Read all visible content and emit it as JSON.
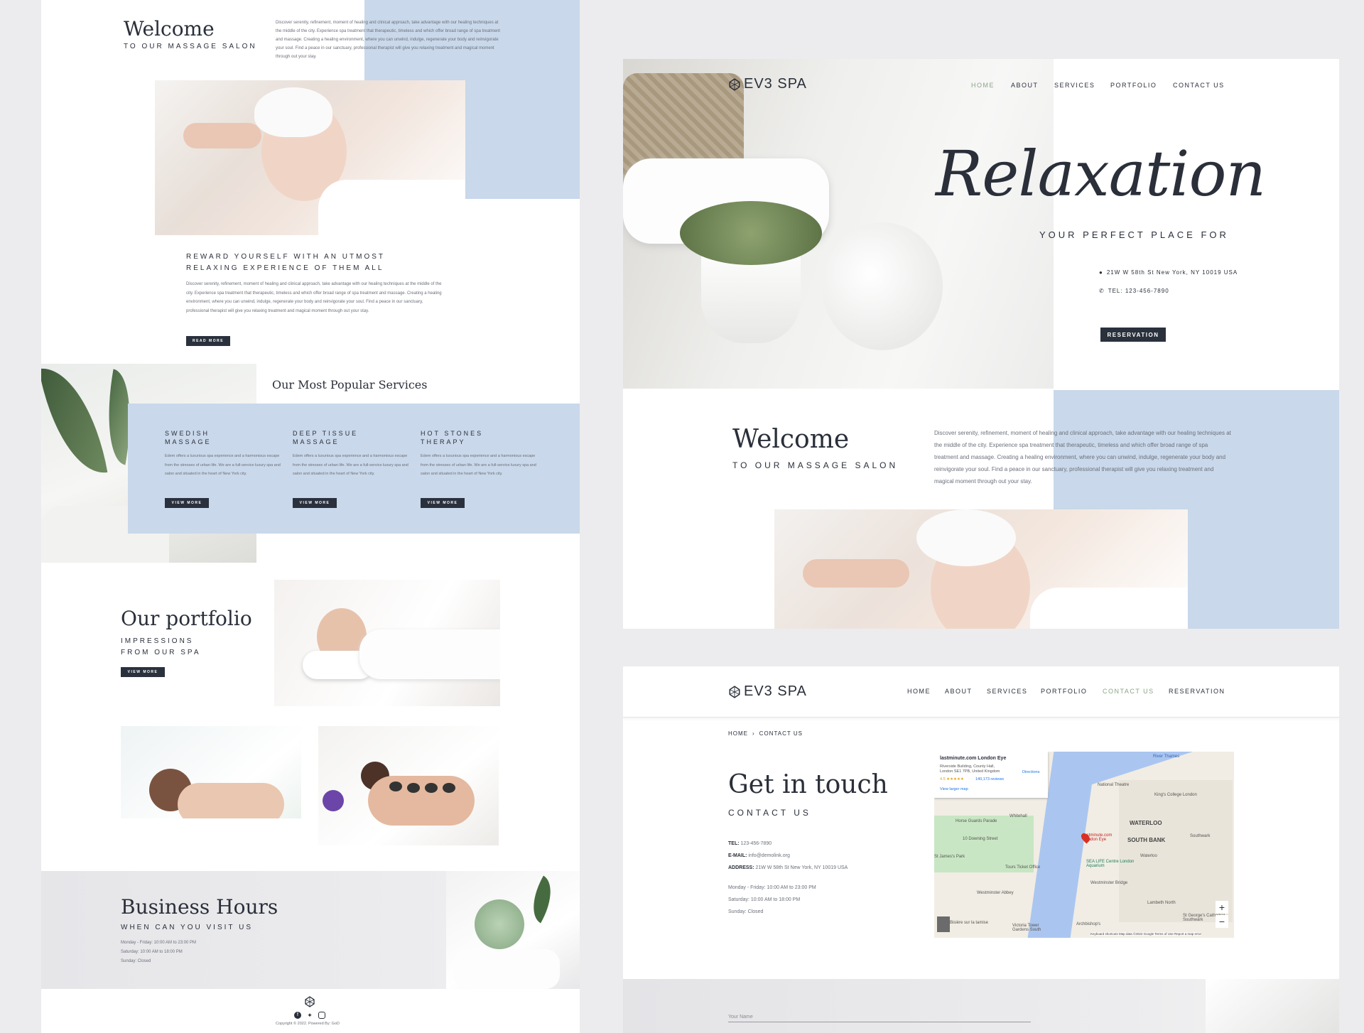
{
  "left_page": {
    "welcome": {
      "title": "Welcome",
      "subtitle": "TO OUR MASSAGE SALON",
      "body": "Discover serenity, refinement, moment of healing and clinical approach, take advantage with our healing techniques at the middle of the city. Experience spa treatment that therapeutic, timeless and which offer broad range of spa treatment and massage. Creating a healing environment, where you can unwind, indulge, regenerate your body and reinvigorate your soul. Find a peace in our sanctuary, professional therapist will give you relaxing treatment and magical moment through out your stay."
    },
    "reward": {
      "heading_line1": "REWARD YOURSELF WITH AN UTMOST",
      "heading_line2": "RELAXING EXPERIENCE OF THEM ALL",
      "body": "Discover serenity, refinement, moment of healing and clinical approach, take advantage with our healing techniques at the middle of the city. Experience spa treatment that therapeutic, timeless and which offer broad range of spa treatment and massage. Creating a healing environment, where you can unwind, indulge, regenerate your body and reinvigorate your soul. Find a peace in our sanctuary, professional therapist will give you relaxing treatment and magical moment through out your stay.",
      "button": "READ MORE"
    },
    "services": {
      "title": "Our Most Popular Services",
      "items": [
        {
          "line1": "SWEDISH",
          "line2": "MASSAGE",
          "body": "Edem offers a luxurious spa experience and a harmonious escape from the stresses of urban life. We are a full-service luxury spa and salon and situated in the heart of New York city.",
          "button": "VIEW MORE"
        },
        {
          "line1": "DEEP TISSUE",
          "line2": "MASSAGE",
          "body": "Edem offers a luxurious spa experience and a harmonious escape from the stresses of urban life. We are a full-service luxury spa and salon and situated in the heart of New York city.",
          "button": "VIEW MORE"
        },
        {
          "line1": "HOT STONES",
          "line2": "THERAPY",
          "body": "Edem offers a luxurious spa experience and a harmonious escape from the stresses of urban life. We are a full-service luxury spa and salon and situated in the heart of New York city.",
          "button": "VIEW MORE"
        }
      ]
    },
    "portfolio": {
      "title": "Our portfolio",
      "sub1": "IMPRESSIONS",
      "sub2": "FROM OUR SPA",
      "button": "VIEW MORE"
    },
    "hours": {
      "title": "Business Hours",
      "subtitle": "WHEN CAN YOU VISIT US",
      "line1": "Monday - Friday: 10:00 AM to 23:00 PM",
      "line2": "Saturday: 10:00 AM to 18:00 PM",
      "line3": "Sunday: Closed"
    },
    "footer": {
      "copyright": "Copyright © 2022. Powered By: GoD"
    }
  },
  "hero_page": {
    "logo": "EV3 SPA",
    "nav": [
      "HOME",
      "ABOUT",
      "SERVICES",
      "PORTFOLIO",
      "CONTACT US"
    ],
    "script_title": "Relaxation",
    "tagline": "YOUR PERFECT PLACE FOR",
    "address": "21W W 58th St New York, NY 10019 USA",
    "phone": "TEL: 123-456-7890",
    "button": "RESERVATION",
    "welcome_title": "Welcome",
    "welcome_subtitle": "TO OUR MASSAGE SALON",
    "welcome_body": "Discover serenity, refinement, moment of healing and clinical approach, take advantage with our healing techniques at the middle of the city. Experience spa treatment that therapeutic, timeless and which offer broad range of spa treatment and massage. Creating a healing environment, where you can unwind, indulge, regenerate your body and reinvigorate your soul. Find a peace in our sanctuary, professional therapist will give you relaxing treatment and magical moment through out your stay."
  },
  "contact_page": {
    "logo": "EV3 SPA",
    "nav": [
      "HOME",
      "ABOUT",
      "SERVICES",
      "PORTFOLIO",
      "CONTACT US",
      "RESERVATION"
    ],
    "breadcrumb_home": "HOME",
    "breadcrumb_current": "CONTACT US",
    "title": "Get in touch",
    "subtitle": "CONTACT US",
    "tel_label": "TEL:",
    "tel_value": "123-456-7890",
    "email_label": "E-MAIL:",
    "email_value": "info@demolink.org",
    "address_label": "ADDRESS:",
    "address_value": "21W W 58th St New York, NY 10019 USA",
    "hours1": "Monday - Friday: 10:00 AM to 23:00 PM",
    "hours2": "Saturday: 10:00 AM to 18:00 PM",
    "hours3": "Sunday: Closed",
    "name_placeholder": "Your Name",
    "map": {
      "place": "lastminute.com London Eye",
      "addr1": "Riverside Building, County Hall,",
      "addr2": "London SE1 7PB, United Kingdom",
      "rating": "4.5 ★★★★★",
      "reviews": "140,173 reviews",
      "larger": "View larger map",
      "directions": "Directions",
      "labels": [
        "River Thames",
        "National Theatre",
        "King's College London",
        "WATERLOO",
        "SOUTH BANK",
        "Horse Guards Parade",
        "Whitehall",
        "10 Downing Street",
        "lastminute.com London Eye",
        "Waterloo",
        "SEA LIFE Centre London Aquarium",
        "Tours Ticket Office",
        "St James's Park",
        "Westminster Abbey",
        "Westminster Bridge",
        "Lambeth North",
        "St George's Cathedral, Southwark",
        "Southwark",
        "Archbishop's",
        "Victoria Tower Gardens South",
        "Bisière sur la tamise"
      ],
      "footer": "Keyboard shortcuts   Map data ©2022 Google   Terms of Use   Report a map error"
    }
  },
  "colors": {
    "accent_blue": "#c9d8ea",
    "dark_button": "#2a313d",
    "active_nav": "#8aa587",
    "background": "#ececee"
  }
}
